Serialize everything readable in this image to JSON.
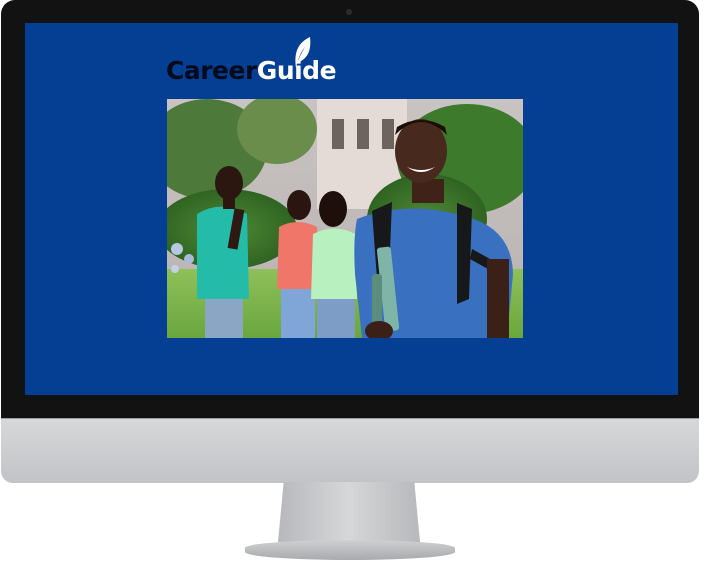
{
  "logo": {
    "career": "Career",
    "guide": "Guide",
    "icon": "leaf-icon"
  },
  "screen": {
    "background": "#043f94"
  },
  "hero_image": {
    "subject": "smiling-student-with-backpack-and-books",
    "icon": "photo-icon"
  }
}
